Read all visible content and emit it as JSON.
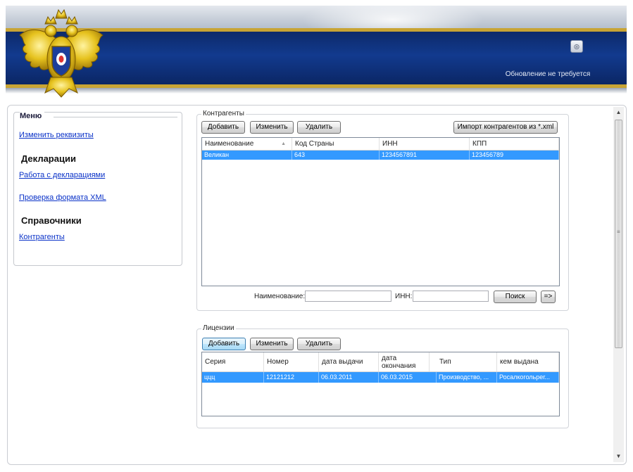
{
  "header": {
    "update_status": "Обновление не требуется"
  },
  "menu": {
    "title": "Меню",
    "items": [
      {
        "type": "link",
        "label": "Изменить реквизиты"
      },
      {
        "type": "section",
        "label": "Декларации"
      },
      {
        "type": "link",
        "label": "Работа с декларациями"
      },
      {
        "type": "link",
        "label": "Проверка формата XML"
      },
      {
        "type": "section",
        "label": "Справочники"
      },
      {
        "type": "link",
        "label": "Контрагенты"
      }
    ]
  },
  "contractors": {
    "title": "Контрагенты",
    "buttons": {
      "add": "Добавить",
      "edit": "Изменить",
      "delete": "Удалить",
      "import": "Импорт контрагентов из *.xml"
    },
    "columns": [
      "Наименование",
      "Код Страны",
      "ИНН",
      "КПП"
    ],
    "rows": [
      [
        "Великан",
        "643",
        "1234567891",
        "123456789"
      ]
    ],
    "search": {
      "name_label": "Наименование:",
      "inn_label": "ИНН:",
      "search_button": "Поиск",
      "next_button": "=>"
    }
  },
  "licenses": {
    "title": "Лицензии",
    "buttons": {
      "add": "Добавить",
      "edit": "Изменить",
      "delete": "Удалить"
    },
    "columns": [
      "Серия",
      "Номер",
      "дата выдачи",
      "дата окончания",
      "Тип",
      "кем выдана"
    ],
    "rows": [
      [
        "ццц",
        "12121212",
        "06.03.2011",
        "06.03.2015",
        "Производство, ...",
        "Росалкогольрег..."
      ]
    ]
  }
}
